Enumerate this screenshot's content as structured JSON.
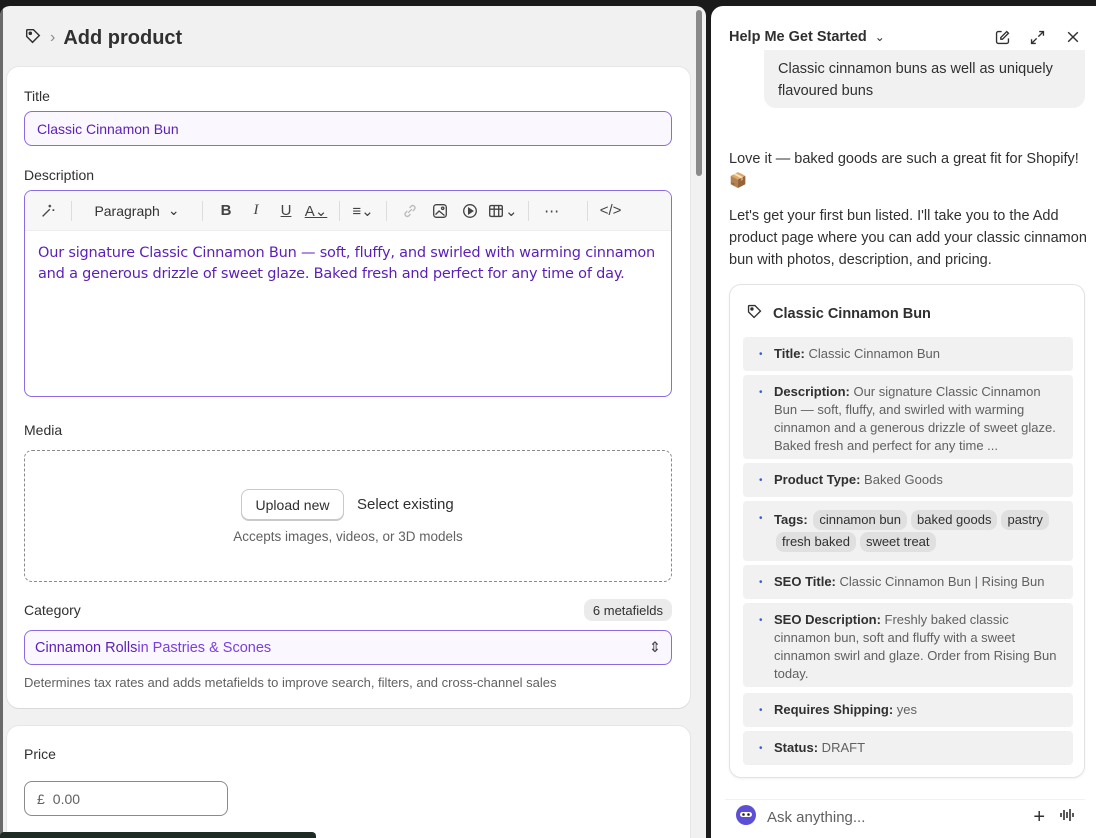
{
  "page": {
    "title": "Add product",
    "title_label": "Title",
    "title_value": "Classic Cinnamon Bun",
    "description_label": "Description",
    "toolbar": {
      "paragraph": "Paragraph"
    },
    "description_text": "Our signature Classic Cinnamon Bun — soft, fluffy, and swirled with warming cinnamon and a generous drizzle of sweet glaze. Baked fresh and perfect for any time of day.",
    "media_label": "Media",
    "upload_new": "Upload new",
    "select_existing": "Select existing",
    "accepts": "Accepts images, videos, or 3D models",
    "category_label": "Category",
    "metafields_badge": "6 metafields",
    "category_value": "Cinnamon Rolls",
    "category_in": " in Pastries & Scones",
    "category_help": "Determines tax rates and adds metafields to improve search, filters, and cross-channel sales",
    "price_label": "Price",
    "currency": "£",
    "price_placeholder": "0.00"
  },
  "assistant": {
    "title": "Help Me Get Started",
    "user_message": "Classic cinnamon buns as well as uniquely flavoured buns",
    "reply_1": "Love it — baked goods are such a great fit for Shopify! 📦",
    "reply_2": "Let's get your first bun listed. I'll take you to the Add product page where you can add your classic cinnamon bun with photos, description, and pricing.",
    "card_title": "Classic Cinnamon Bun",
    "fields": {
      "title_k": "Title:",
      "title_v": " Classic Cinnamon Bun",
      "desc_k": "Description:",
      "desc_v": " Our signature Classic Cinnamon Bun — soft, fluffy, and swirled with warming cinnamon and a generous drizzle of sweet glaze. Baked fresh and perfect for any time ...",
      "type_k": "Product Type:",
      "type_v": " Baked Goods",
      "tags_k": "Tags:",
      "tags": [
        "cinnamon bun",
        "baked goods",
        "pastry",
        "fresh baked",
        "sweet treat"
      ],
      "seo_title_k": "SEO Title:",
      "seo_title_v": " Classic Cinnamon Bun | Rising Bun",
      "seo_desc_k": "SEO Description:",
      "seo_desc_v": " Freshly baked classic cinnamon bun, soft and fluffy with a sweet cinnamon swirl and glaze. Order from Rising Bun today.",
      "ship_k": "Requires Shipping:",
      "ship_v": " yes",
      "status_k": "Status:",
      "status_v": " DRAFT"
    },
    "ask_placeholder": "Ask anything..."
  }
}
